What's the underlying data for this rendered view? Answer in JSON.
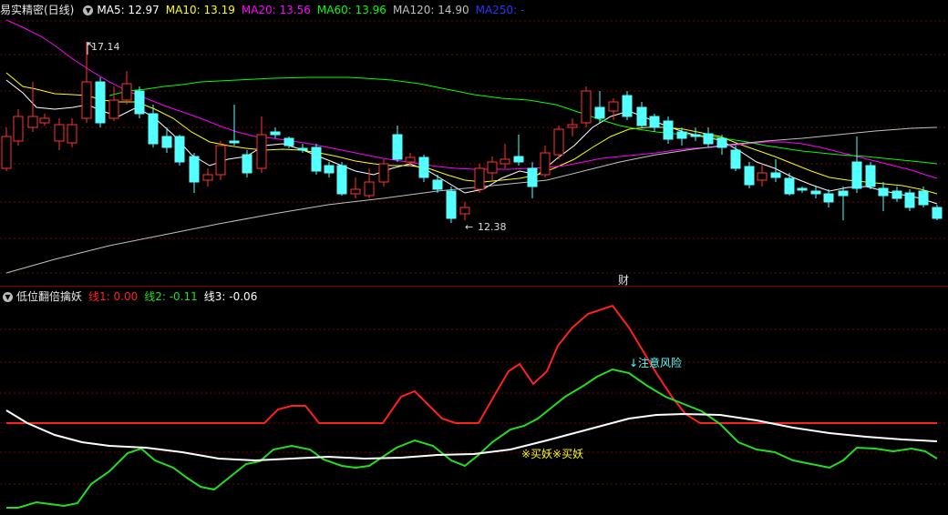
{
  "main_header": {
    "title": "易实精密(日线)",
    "ma5": "MA5: 12.97",
    "ma10": "MA10: 13.19",
    "ma20": "MA20: 13.56",
    "ma60": "MA60: 13.96",
    "ma120": "MA120: 14.90",
    "ma250": "MA250: -"
  },
  "indicator_header": {
    "title": "低位翻倍擒妖",
    "line1": "线1: 0.00",
    "line2": "线2: -0.11",
    "line3": "线3: -0.06"
  },
  "annotations": {
    "high_label": "17.14",
    "low_label": "12.38",
    "caibao": "财",
    "risk": "↓注意风险",
    "buy": "※买妖※买妖"
  },
  "colors": {
    "up": "#ff3232",
    "down": "#54ffff",
    "ma5": "#ffffff",
    "ma10": "#ffff00",
    "ma20": "#ff00ff",
    "ma60": "#00ff00",
    "ma120": "#c0c0c0",
    "ma250": "#0000ff",
    "line1": "#ff2020",
    "line2": "#22dd22",
    "line3": "#ffffff",
    "grid": "#7a0000"
  }
}
